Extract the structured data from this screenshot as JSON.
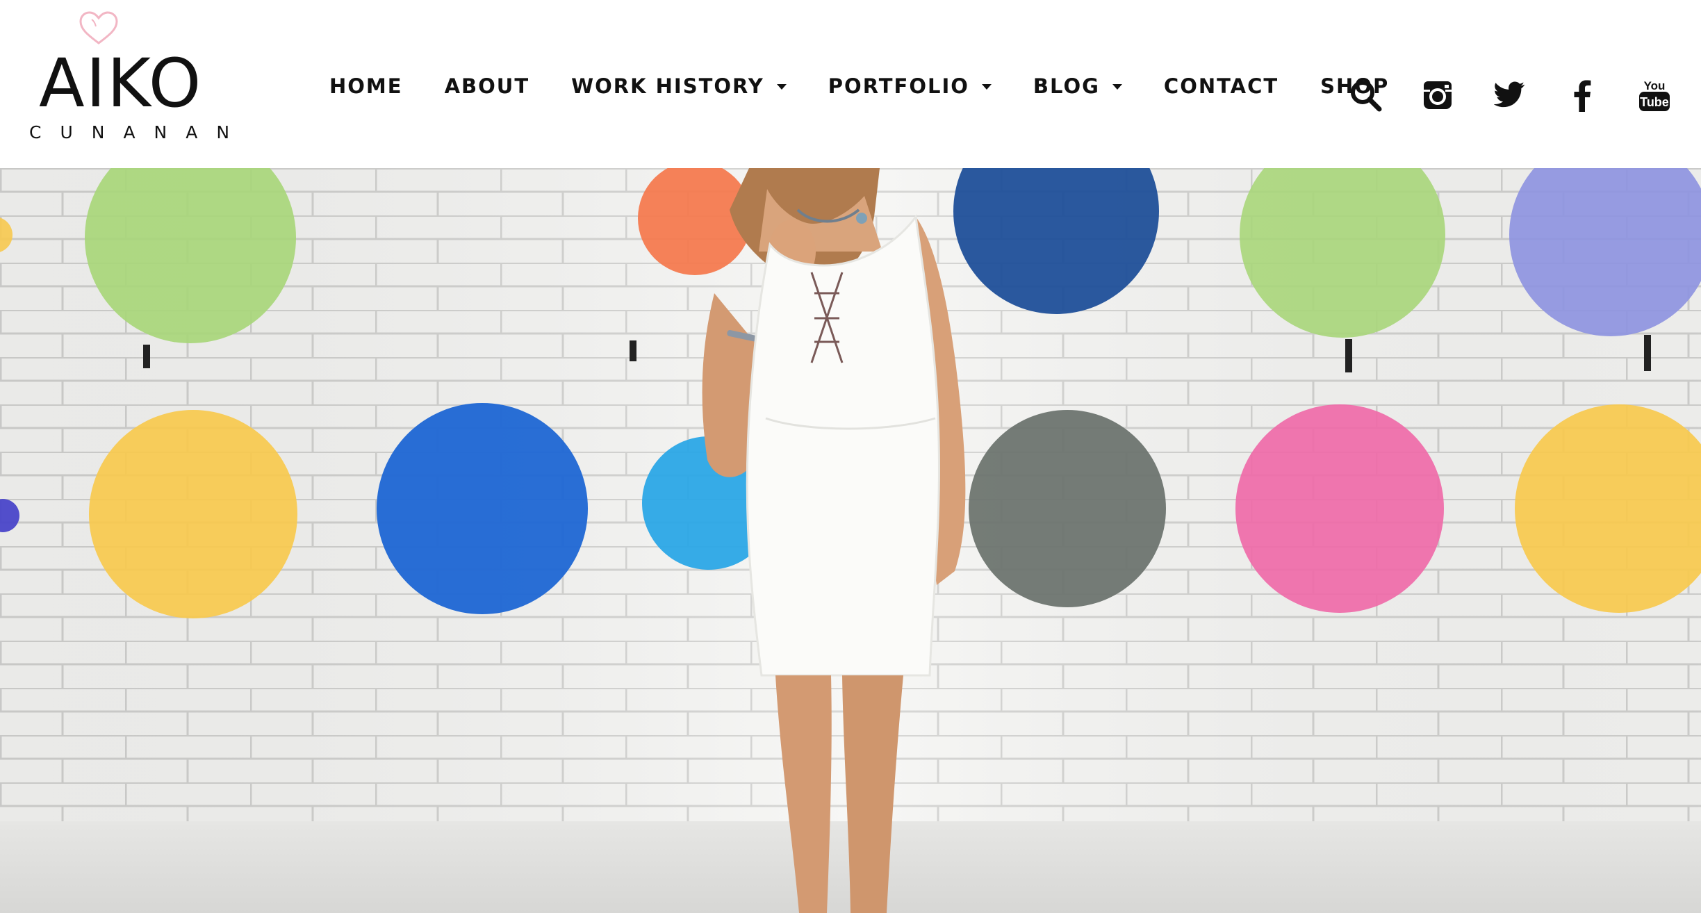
{
  "logo": {
    "main": "AIKO",
    "sub": "CUNANAN",
    "heart_icon": "heart-outline-icon",
    "heart_color": "#f2b6c4"
  },
  "nav": {
    "items": [
      {
        "label": "HOME",
        "has_dropdown": false
      },
      {
        "label": "ABOUT",
        "has_dropdown": false
      },
      {
        "label": "WORK HISTORY",
        "has_dropdown": true
      },
      {
        "label": "PORTFOLIO",
        "has_dropdown": true
      },
      {
        "label": "BLOG",
        "has_dropdown": true
      },
      {
        "label": "CONTACT",
        "has_dropdown": false
      },
      {
        "label": "SHOP",
        "has_dropdown": false
      }
    ]
  },
  "social": {
    "icons": [
      "search-icon",
      "instagram-icon",
      "twitter-icon",
      "facebook-icon",
      "youtube-icon"
    ],
    "youtube_top": "You",
    "youtube_bottom": "Tube"
  },
  "hero": {
    "description_icon": "hero-photo",
    "dot_colors": {
      "green": "#a8d67a",
      "orange": "#f47a4f",
      "navy": "#1f4f99",
      "lavender": "#8e94df",
      "yellow": "#f7c94f",
      "blue": "#1e66d4",
      "sky": "#2ba6e6",
      "gray": "#6b726d",
      "pink": "#ef6aa8",
      "violet": "#4a46c9"
    }
  }
}
